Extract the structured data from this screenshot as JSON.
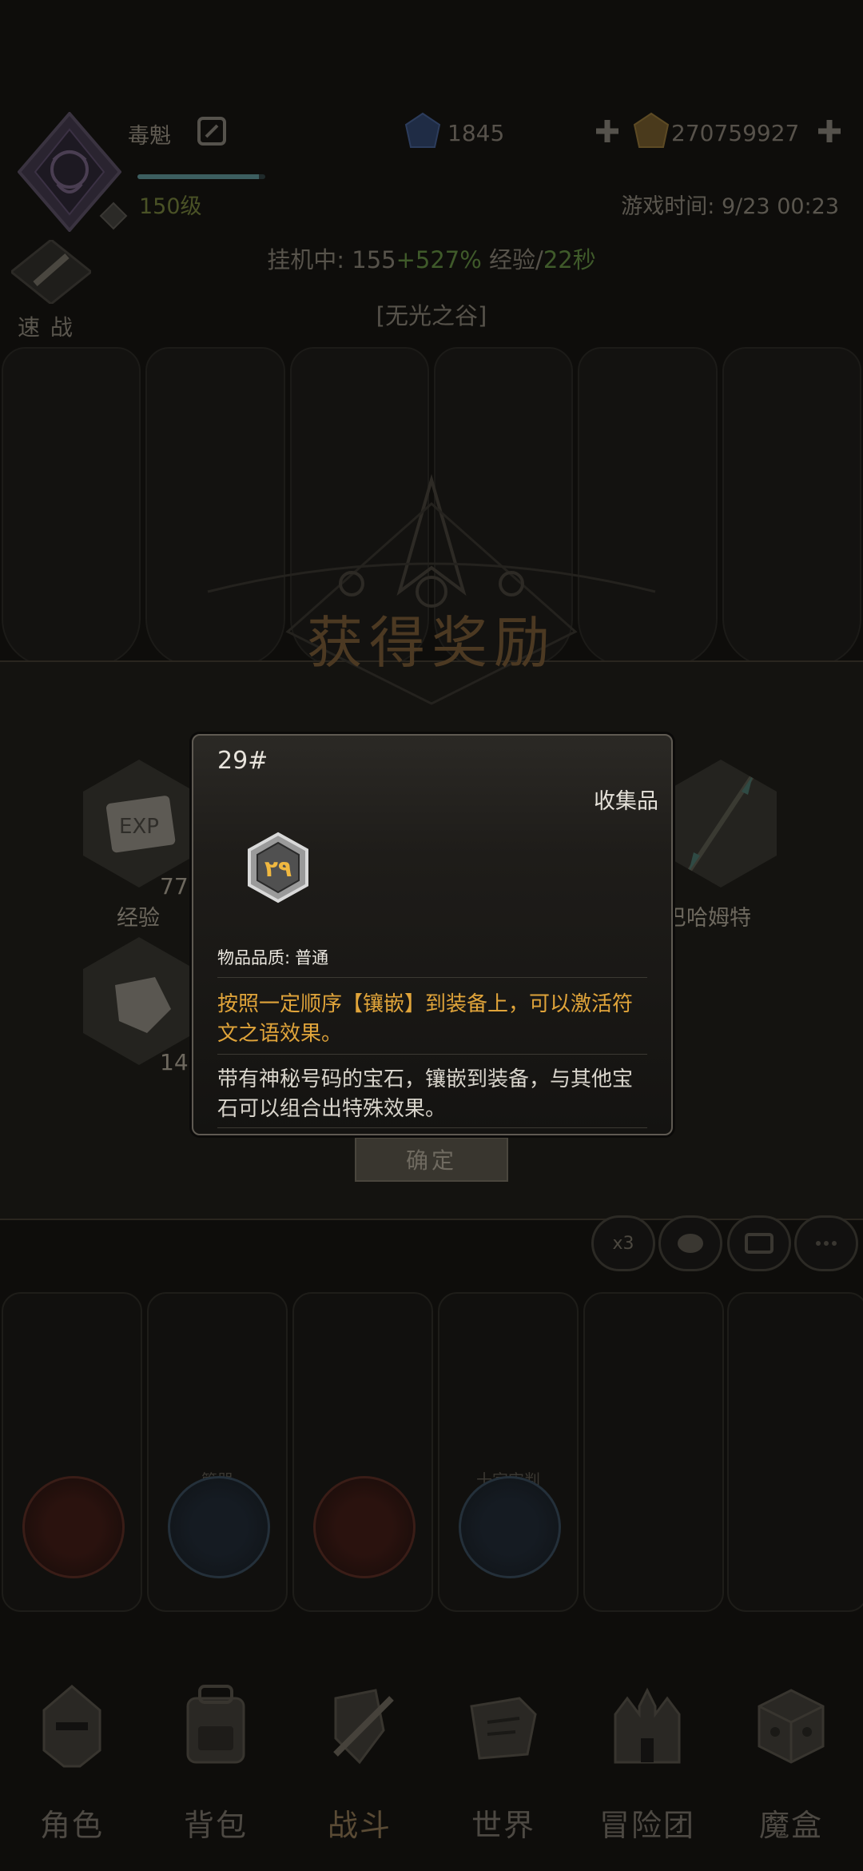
{
  "header": {
    "player_name": "毒魁",
    "player_level": "150级",
    "xp_progress": 0.95,
    "gems": "1845",
    "gold": "270759927",
    "game_time": "游戏时间: 9/23 00:23"
  },
  "quick_battle": {
    "label": "速 战"
  },
  "idle": {
    "prefix": "挂机中: 155",
    "bonus": "+527%",
    "middle": " 经验/",
    "rate": "22秒"
  },
  "zone": "[无光之谷]",
  "reward": {
    "title": "获得奖励",
    "exp_count": "77",
    "exp_label": "经验",
    "exp_icon_text": "EXP",
    "material_count": "14",
    "weapon_label": "巴哈姆特",
    "confirm_label": "确定"
  },
  "actions": {
    "speed": "x3"
  },
  "cards": [
    {
      "label": ""
    },
    {
      "label": "管器"
    },
    {
      "label": ""
    },
    {
      "label": "十字审判"
    },
    {
      "label": ""
    },
    {
      "label": ""
    }
  ],
  "nav": {
    "items": [
      {
        "label": "角色",
        "icon": "helmet-icon"
      },
      {
        "label": "背包",
        "icon": "backpack-icon"
      },
      {
        "label": "战斗",
        "icon": "sword-shield-icon"
      },
      {
        "label": "世界",
        "icon": "map-icon"
      },
      {
        "label": "冒险团",
        "icon": "castle-icon"
      },
      {
        "label": "魔盒",
        "icon": "cube-icon"
      }
    ]
  },
  "item_modal": {
    "name": "29#",
    "type": "收集品",
    "icon_text": "٢٩",
    "quality_label": "物品品质:",
    "quality_value": "普通",
    "effect": "按照一定顺序【镶嵌】到装备上，可以激活符文之语效果。",
    "description": "带有神秘号码的宝石，镶嵌到装备，与其他宝石可以组合出特殊效果。"
  },
  "colors": {
    "accent_gold": "#e0a43a",
    "modal_border": "#5f5a52",
    "background": "#0e0d0b"
  }
}
